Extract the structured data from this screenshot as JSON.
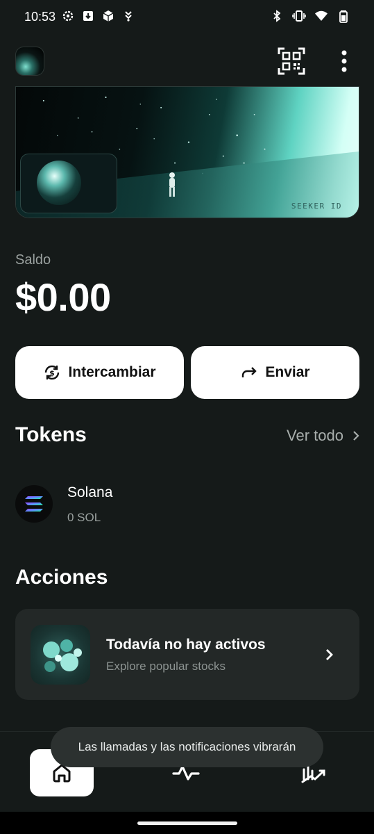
{
  "status_bar": {
    "time": "10:53",
    "left_icons": [
      "gear-icon",
      "download-icon",
      "shield-app-icon",
      "location-app-icon"
    ],
    "right_icons": [
      "bluetooth-icon",
      "vibrate-icon",
      "wifi-icon",
      "battery-icon"
    ]
  },
  "header": {
    "avatar": "avatar",
    "qr_icon": "qr-code-icon",
    "menu_icon": "more-vertical-icon"
  },
  "hero": {
    "label": "SEEKER ID"
  },
  "balance": {
    "label": "Saldo",
    "value": "$0.00"
  },
  "actions": {
    "swap_label": "Intercambiar",
    "send_label": "Enviar"
  },
  "tokens": {
    "title": "Tokens",
    "see_all": "Ver todo",
    "items": [
      {
        "name": "Solana",
        "amount": "0 SOL"
      }
    ]
  },
  "acciones": {
    "title": "Acciones",
    "empty_title": "Todavía no hay activos",
    "empty_subtitle": "Explore popular stocks"
  },
  "nav": {
    "items": [
      "home-icon",
      "activity-icon",
      "markets-icon"
    ],
    "active": "home"
  },
  "toast": {
    "text": "Las llamadas y las notificaciones vibrarán"
  },
  "colors": {
    "background": "#151a19",
    "card": "#232827",
    "accent": "#5fd3c2",
    "muted_text": "#9aa19f"
  }
}
